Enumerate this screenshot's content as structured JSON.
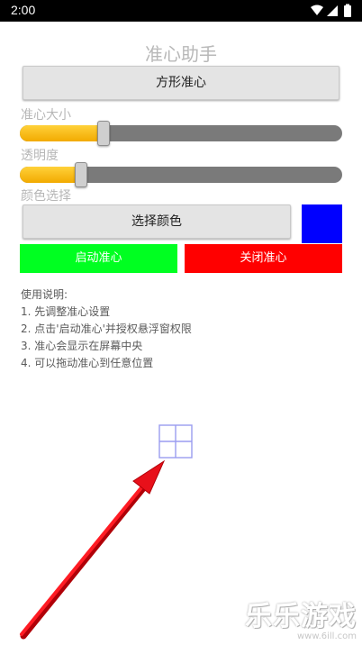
{
  "status_bar": {
    "time": "2:00",
    "icons": [
      "wifi-icon",
      "signal-icon",
      "battery-icon"
    ]
  },
  "app": {
    "title": "准心助手"
  },
  "shape_button": {
    "label": "方形准心"
  },
  "size": {
    "label": "准心大小",
    "value_fraction": 0.26
  },
  "opacity": {
    "label": "透明度",
    "value_fraction": 0.19
  },
  "color": {
    "label": "颜色选择",
    "button_label": "选择颜色",
    "selected_color": "#0000ff"
  },
  "actions": {
    "start_label": "启动准心",
    "start_color": "#00ff21",
    "stop_label": "关闭准心",
    "stop_color": "#ff0000"
  },
  "instructions": {
    "heading": "使用说明:",
    "items": [
      "1. 先调整准心设置",
      "2. 点击'启动准心'并授权悬浮窗权限",
      "3. 准心会显示在屏幕中央",
      "4. 可以拖动准心到任意位置"
    ]
  },
  "watermark": {
    "text": "乐乐游戏",
    "url": "www.6ill.com"
  },
  "colors": {
    "accent": "#f5b400",
    "arrow": "#e8101a"
  }
}
